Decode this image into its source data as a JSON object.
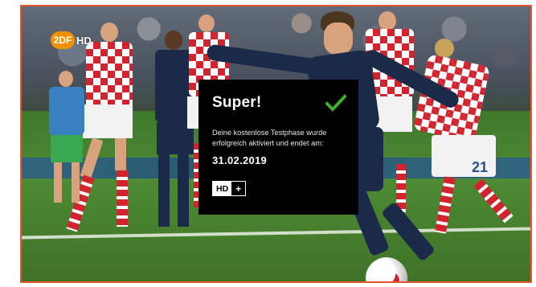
{
  "channel_logo": {
    "badge_text": "2DF",
    "suffix_text": "HD",
    "badge_color": "#f39200"
  },
  "dialog": {
    "title": "Super!",
    "status_icon": "check-icon",
    "status_icon_color": "#3fae2a",
    "message": "Deine kostenlose Testphase wurde\nerfolgreich aktiviert und endet am:",
    "end_date": "31.02.2019",
    "brand_badge": {
      "hd": "HD",
      "plus": "+"
    }
  },
  "scene": {
    "player_number": "21"
  },
  "colors": {
    "frame_border": "#e8562e",
    "dialog_background": "#000000"
  }
}
